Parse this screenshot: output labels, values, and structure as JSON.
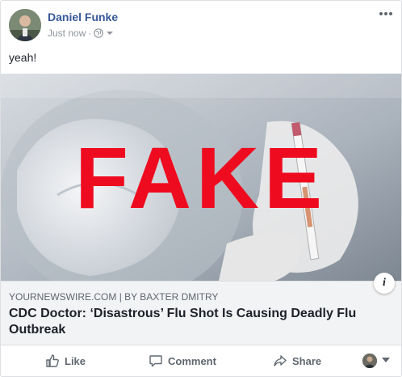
{
  "post": {
    "author": "Daniel Funke",
    "timestamp": "Just now",
    "separator": "·",
    "privacy_icon": "globe-icon",
    "text": "yeah!"
  },
  "link": {
    "image_overlay_text": "FAKE",
    "domain": "YOURNEWSWIRE.COM",
    "by_label": "| BY",
    "author": "BAXTER DMITRY",
    "headline": "CDC Doctor: ‘Disastrous’ Flu Shot Is Causing Deadly Flu Outbreak",
    "info_label": "i"
  },
  "actions": {
    "like": "Like",
    "comment": "Comment",
    "share": "Share"
  },
  "colors": {
    "author_link": "#365899",
    "overlay_red": "#ef0b1f",
    "muted": "#606770",
    "link_bg": "#f2f3f5"
  }
}
